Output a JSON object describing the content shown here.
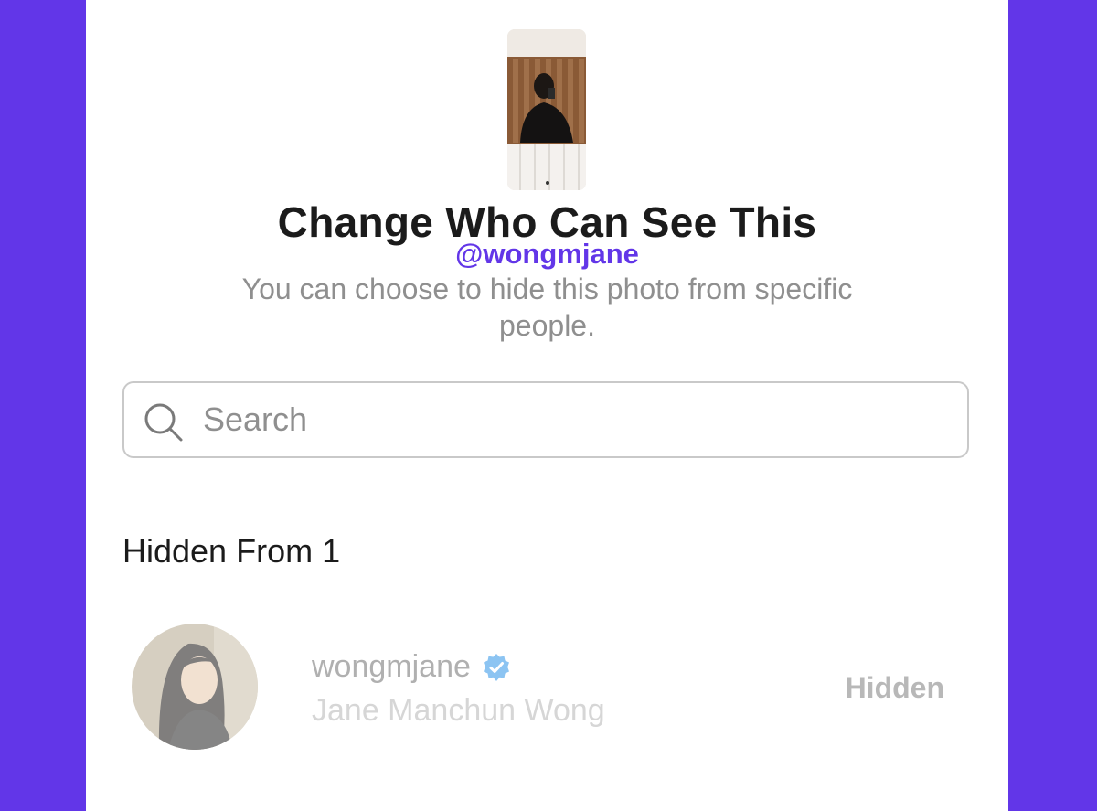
{
  "header": {
    "title": "Change Who Can See This",
    "watermark": "@wongmjane",
    "subtitle": "You can choose to hide this photo from specific people."
  },
  "search": {
    "placeholder": "Search",
    "value": "",
    "icon": "search-icon"
  },
  "hidden_section": {
    "title": "Hidden From 1",
    "users": [
      {
        "username": "wongmjane",
        "full_name": "Jane Manchun Wong",
        "verified": true,
        "status": "Hidden"
      }
    ]
  },
  "colors": {
    "background": "#6236e8",
    "card": "#ffffff",
    "watermark": "#6236e8",
    "verified": "#3897f0"
  }
}
